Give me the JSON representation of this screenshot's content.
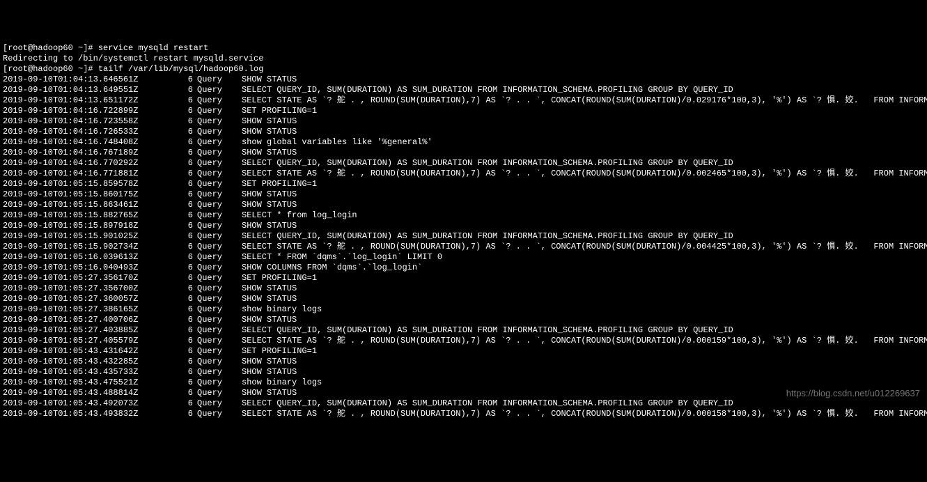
{
  "prompt1": "[root@hadoop60 ~]# service mysqld restart",
  "redirect": "Redirecting to /bin/systemctl restart mysqld.service",
  "prompt2": "[root@hadoop60 ~]# tailf /var/lib/mysql/hadoop60.log",
  "watermark": "https://blog.csdn.net/u012269637",
  "rows": [
    {
      "ts": "2019-09-10T01:04:13.646561Z",
      "id": "6",
      "type": "Query",
      "q": "SHOW STATUS"
    },
    {
      "ts": "2019-09-10T01:04:13.649551Z",
      "id": "6",
      "type": "Query",
      "q": "SELECT QUERY_ID, SUM(DURATION) AS SUM_DURATION FROM INFORMATION_SCHEMA.PROFILING GROUP BY QUERY_ID"
    },
    {
      "ts": "2019-09-10T01:04:13.651172Z",
      "id": "6",
      "type": "Query",
      "q": "SELECT STATE AS `? 舵 . , ROUND(SUM(DURATION),7) AS `? . . `, CONCAT(ROUND(SUM(DURATION)/0.029176*100,3), '%') AS `? 惧. 姣.   FROM INFORMATION"
    },
    {
      "ts": "2019-09-10T01:04:16.722899Z",
      "id": "6",
      "type": "Query",
      "q": "SET PROFILING=1"
    },
    {
      "ts": "2019-09-10T01:04:16.723558Z",
      "id": "6",
      "type": "Query",
      "q": "SHOW STATUS"
    },
    {
      "ts": "2019-09-10T01:04:16.726533Z",
      "id": "6",
      "type": "Query",
      "q": "SHOW STATUS"
    },
    {
      "ts": "2019-09-10T01:04:16.748408Z",
      "id": "6",
      "type": "Query",
      "q": "show global variables like '%general%'"
    },
    {
      "ts": "2019-09-10T01:04:16.767189Z",
      "id": "6",
      "type": "Query",
      "q": "SHOW STATUS"
    },
    {
      "ts": "2019-09-10T01:04:16.770292Z",
      "id": "6",
      "type": "Query",
      "q": "SELECT QUERY_ID, SUM(DURATION) AS SUM_DURATION FROM INFORMATION_SCHEMA.PROFILING GROUP BY QUERY_ID"
    },
    {
      "ts": "2019-09-10T01:04:16.771881Z",
      "id": "6",
      "type": "Query",
      "q": "SELECT STATE AS `? 舵 . , ROUND(SUM(DURATION),7) AS `? . . `, CONCAT(ROUND(SUM(DURATION)/0.002465*100,3), '%') AS `? 惧. 姣.   FROM INFORMATION"
    },
    {
      "ts": "2019-09-10T01:05:15.859578Z",
      "id": "6",
      "type": "Query",
      "q": "SET PROFILING=1"
    },
    {
      "ts": "2019-09-10T01:05:15.860175Z",
      "id": "6",
      "type": "Query",
      "q": "SHOW STATUS"
    },
    {
      "ts": "2019-09-10T01:05:15.863461Z",
      "id": "6",
      "type": "Query",
      "q": "SHOW STATUS"
    },
    {
      "ts": "2019-09-10T01:05:15.882765Z",
      "id": "6",
      "type": "Query",
      "q": "SELECT * from log_login"
    },
    {
      "ts": "2019-09-10T01:05:15.897918Z",
      "id": "6",
      "type": "Query",
      "q": "SHOW STATUS"
    },
    {
      "ts": "2019-09-10T01:05:15.901025Z",
      "id": "6",
      "type": "Query",
      "q": "SELECT QUERY_ID, SUM(DURATION) AS SUM_DURATION FROM INFORMATION_SCHEMA.PROFILING GROUP BY QUERY_ID"
    },
    {
      "ts": "2019-09-10T01:05:15.902734Z",
      "id": "6",
      "type": "Query",
      "q": "SELECT STATE AS `? 舵 . , ROUND(SUM(DURATION),7) AS `? . . `, CONCAT(ROUND(SUM(DURATION)/0.004425*100,3), '%') AS `? 惧. 姣.   FROM INFORMATION"
    },
    {
      "ts": "2019-09-10T01:05:16.039613Z",
      "id": "6",
      "type": "Query",
      "q": "SELECT * FROM `dqms`.`log_login` LIMIT 0"
    },
    {
      "ts": "2019-09-10T01:05:16.040493Z",
      "id": "6",
      "type": "Query",
      "q": "SHOW COLUMNS FROM `dqms`.`log_login`"
    },
    {
      "ts": "2019-09-10T01:05:27.356170Z",
      "id": "6",
      "type": "Query",
      "q": "SET PROFILING=1"
    },
    {
      "ts": "2019-09-10T01:05:27.356700Z",
      "id": "6",
      "type": "Query",
      "q": "SHOW STATUS"
    },
    {
      "ts": "2019-09-10T01:05:27.360057Z",
      "id": "6",
      "type": "Query",
      "q": "SHOW STATUS"
    },
    {
      "ts": "2019-09-10T01:05:27.386165Z",
      "id": "6",
      "type": "Query",
      "q": "show binary logs"
    },
    {
      "ts": "2019-09-10T01:05:27.400706Z",
      "id": "6",
      "type": "Query",
      "q": "SHOW STATUS"
    },
    {
      "ts": "2019-09-10T01:05:27.403885Z",
      "id": "6",
      "type": "Query",
      "q": "SELECT QUERY_ID, SUM(DURATION) AS SUM_DURATION FROM INFORMATION_SCHEMA.PROFILING GROUP BY QUERY_ID"
    },
    {
      "ts": "2019-09-10T01:05:27.405579Z",
      "id": "6",
      "type": "Query",
      "q": "SELECT STATE AS `? 舵 . , ROUND(SUM(DURATION),7) AS `? . . `, CONCAT(ROUND(SUM(DURATION)/0.000159*100,3), '%') AS `? 惧. 姣.   FROM INFORMATION"
    },
    {
      "ts": "2019-09-10T01:05:43.431642Z",
      "id": "6",
      "type": "Query",
      "q": "SET PROFILING=1"
    },
    {
      "ts": "2019-09-10T01:05:43.432285Z",
      "id": "6",
      "type": "Query",
      "q": "SHOW STATUS"
    },
    {
      "ts": "2019-09-10T01:05:43.435733Z",
      "id": "6",
      "type": "Query",
      "q": "SHOW STATUS"
    },
    {
      "ts": "2019-09-10T01:05:43.475521Z",
      "id": "6",
      "type": "Query",
      "q": "show binary logs"
    },
    {
      "ts": "2019-09-10T01:05:43.488814Z",
      "id": "6",
      "type": "Query",
      "q": "SHOW STATUS"
    },
    {
      "ts": "2019-09-10T01:05:43.492073Z",
      "id": "6",
      "type": "Query",
      "q": "SELECT QUERY_ID, SUM(DURATION) AS SUM_DURATION FROM INFORMATION_SCHEMA.PROFILING GROUP BY QUERY_ID"
    },
    {
      "ts": "2019-09-10T01:05:43.493832Z",
      "id": "6",
      "type": "Query",
      "q": "SELECT STATE AS `? 舵 . , ROUND(SUM(DURATION),7) AS `? . . `, CONCAT(ROUND(SUM(DURATION)/0.000158*100,3), '%') AS `? 惧. 姣.   FROM INFORMATION"
    }
  ]
}
